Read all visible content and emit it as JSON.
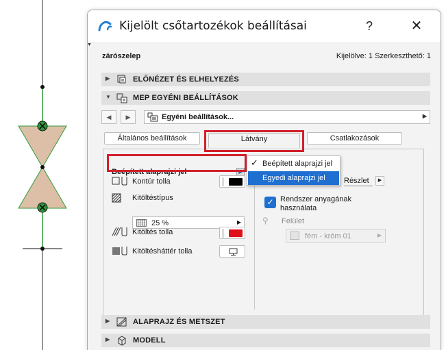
{
  "dialog": {
    "title": "Kijelölt csőtartozékok beállításai",
    "help_label": "?",
    "close_label": "✕",
    "element_name": "zárószelep",
    "selection_info": "Kijelölve: 1 Szerkeszthető: 1"
  },
  "sections": {
    "preview": "ELŐNÉZET ÉS ELHELYEZÉS",
    "mep_custom": "MEP EGYÉNI BEÁLLÍTÁSOK",
    "floorplan": "ALAPRAJZ ÉS METSZET",
    "model": "MODELL"
  },
  "preset": {
    "value": "Egyéni beállítások...",
    "prev_label": "◀",
    "next_label": "▶"
  },
  "tabs": [
    {
      "label": "Általános beállítások"
    },
    {
      "label": "Látvány"
    },
    {
      "label": "Csatlakozások"
    }
  ],
  "left_panel": {
    "symbol_select": "Beépített alaprajzi jel",
    "contour_pen_label": "Kontúr tolla",
    "fill_type_label": "Kitöltéstípus",
    "fill_type_value": "25 %",
    "fill_pen_label": "Kitöltés tolla",
    "fill_bg_pen_label": "Kitöltésháttér tolla"
  },
  "dropdown": {
    "items": [
      {
        "label": "Beépített alaprajzi jel",
        "checked": "✓"
      },
      {
        "label": "Egyedi alaprajzi jel",
        "checked": ""
      }
    ]
  },
  "right_panel": {
    "detail_label": "Részlet",
    "system_material_label": "Rendszer anyagának használata",
    "surface_label": "Felület",
    "surface_value": "fém - króm 01"
  },
  "colors": {
    "contour_pen": "#000000",
    "fill_pen": "#e0101a",
    "highlight_frame": "#d1202a",
    "accent": "#1f6fd1",
    "valve_fill": "#dcbfa6",
    "valve_stroke": "#2e9a3a"
  },
  "icons": {
    "app": "archicad-logo-icon",
    "preview": "preview-placement-icon",
    "mep": "mep-settings-icon",
    "floorplan": "floorplan-section-icon",
    "model": "model-cube-icon"
  }
}
